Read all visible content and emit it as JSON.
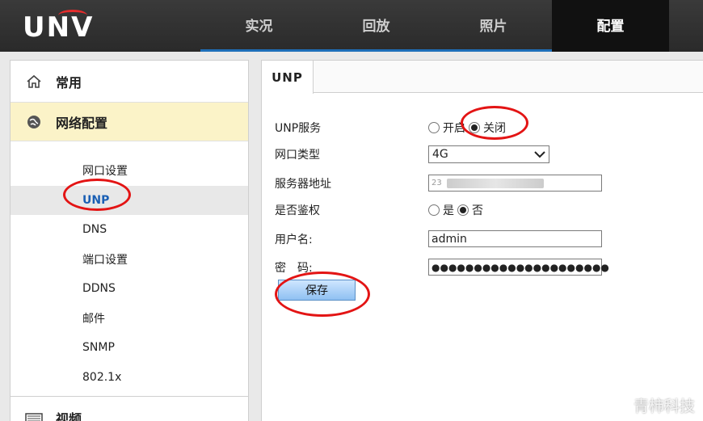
{
  "brand": {
    "logo": "UNV"
  },
  "nav": {
    "tabs": [
      {
        "label": "实况"
      },
      {
        "label": "回放"
      },
      {
        "label": "照片"
      },
      {
        "label": "配置",
        "active": true
      }
    ]
  },
  "sidebar": {
    "general": "常用",
    "network": "网络配置",
    "items": [
      "网口设置",
      "UNP",
      "DNS",
      "端口设置",
      "DDNS",
      "邮件",
      "SNMP",
      "802.1x"
    ],
    "active_item": "UNP",
    "video": "视频"
  },
  "main": {
    "tab": "UNP",
    "fields": {
      "service_label": "UNP服务",
      "service_on": "开启",
      "service_off": "关闭",
      "service_value": "关闭",
      "nettype_label": "网口类型",
      "nettype_value": "4G",
      "server_label": "服务器地址",
      "server_value_visible": "23",
      "auth_label": "是否鉴权",
      "auth_yes": "是",
      "auth_no": "否",
      "auth_value": "否",
      "username_label": "用户名:",
      "username_value": "admin",
      "password_label": "密　码:",
      "password_value": "●●●●●●●●●●●●●●●●●●●●●"
    },
    "save_label": "保存"
  },
  "watermark": "青柿科技",
  "colors": {
    "accent_blue": "#1e6fb8",
    "annotation_red": "#e31414",
    "highlight_yellow": "#fbf3c8"
  }
}
